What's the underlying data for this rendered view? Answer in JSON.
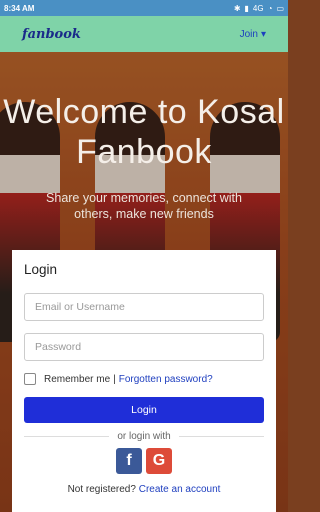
{
  "status_bar": {
    "time": "8:34 AM",
    "network": "4G",
    "battery_icon": "battery-icon"
  },
  "navbar": {
    "brand": "fanbook",
    "join_label": "Join"
  },
  "hero": {
    "title": "Welcome to Kosal Fanbook",
    "subtitle": "Share your memories, connect with others, make new friends"
  },
  "login": {
    "title": "Login",
    "email_placeholder": "Email or Username",
    "password_placeholder": "Password",
    "remember_label": "Remember me",
    "separator": "|",
    "forgot_label": "Forgotten password?",
    "login_button": "Login",
    "or_login_with": "or login with",
    "social": [
      {
        "name": "facebook-icon",
        "glyph": "f",
        "color": "#3b5998"
      },
      {
        "name": "google-icon",
        "glyph": "G",
        "color": "#dd4b39"
      }
    ],
    "not_registered": "Not registered?",
    "create_account": "Create an account"
  },
  "colors": {
    "navbar_bg": "#7fd3a8",
    "login_button_bg": "#1f2ed8",
    "link": "#1f3fbf"
  }
}
